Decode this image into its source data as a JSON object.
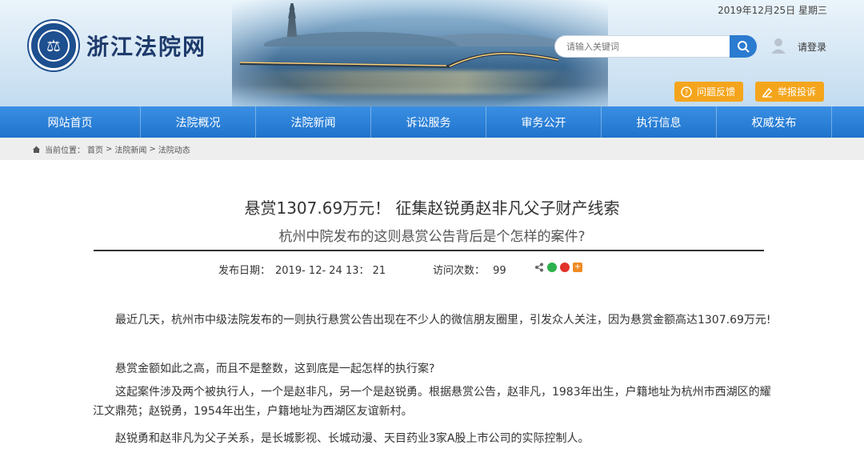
{
  "header": {
    "date": "2019年12月25日 星期三",
    "site_name": "浙江法院网",
    "emblem_text": "⚖",
    "search_placeholder": "请输入关键词",
    "login": "请登录",
    "feedback": "问题反馈",
    "report": "举报投诉"
  },
  "nav": [
    "网站首页",
    "法院概况",
    "法院新闻",
    "诉讼服务",
    "审务公开",
    "执行信息",
    "权威发布"
  ],
  "breadcrumb": {
    "label": "当前位置：",
    "items": [
      "首页",
      ">",
      "法院新闻",
      ">",
      "法院动态"
    ]
  },
  "article": {
    "title": "悬赏1307.69万元！ 征集赵锐勇赵非凡父子财产线索",
    "subtitle": "杭州中院发布的这则悬赏公告背后是个怎样的案件?",
    "publish_label": "发布日期：",
    "publish_date": "2019- 12- 24 13： 21",
    "visits_label": "访问次数：",
    "visits": "99",
    "paragraphs": [
      "最近几天，杭州市中级法院发布的一则执行悬赏公告出现在不少人的微信朋友圈里，引发众人关注，因为悬赏金额高达1307.69万元!",
      "悬赏金额如此之高，而且不是整数，这到底是一起怎样的执行案?",
      "这起案件涉及两个被执行人，一个是赵非凡，另一个是赵锐勇。根据悬赏公告，赵非凡，1983年出生，户籍地址为杭州市西湖区的耀江文鼎苑；赵锐勇，1954年出生，户籍地址为西湖区友谊新村。",
      "赵锐勇和赵非凡为父子关系，是长城影视、长城动漫、天目药业3家A股上市公司的实际控制人。"
    ]
  },
  "colors": {
    "nav": "#2a80d8",
    "accent_orange": "#f4a51c",
    "search_button": "#2b7bd0"
  }
}
